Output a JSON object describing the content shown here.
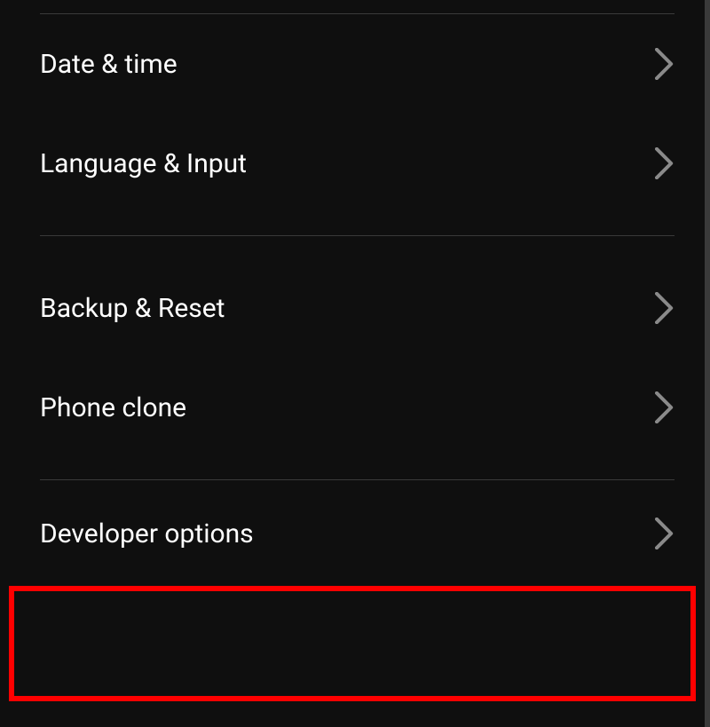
{
  "settings": {
    "items": [
      {
        "label": "Date & time"
      },
      {
        "label": "Language & Input"
      },
      {
        "label": "Backup & Reset"
      },
      {
        "label": "Phone clone"
      },
      {
        "label": "Developer options"
      }
    ]
  },
  "highlight": {
    "color": "#ff0000",
    "target": "developer-options"
  }
}
